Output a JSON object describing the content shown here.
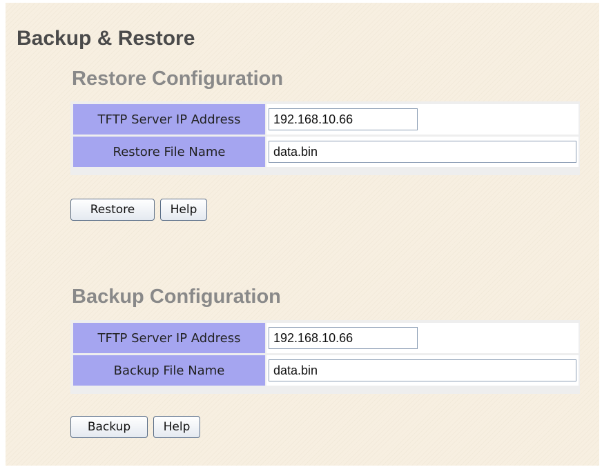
{
  "page": {
    "title": "Backup & Restore"
  },
  "restore": {
    "title": "Restore Configuration",
    "tftp_label": "TFTP Server IP Address",
    "tftp_value": "192.168.10.66",
    "file_label": "Restore File Name",
    "file_value": "data.bin",
    "action_button": "Restore",
    "help_button": "Help"
  },
  "backup": {
    "title": "Backup Configuration",
    "tftp_label": "TFTP Server IP Address",
    "tftp_value": "192.168.10.66",
    "file_label": "Backup File Name",
    "file_value": "data.bin",
    "action_button": "Backup",
    "help_button": "Help"
  },
  "colors": {
    "page_background": "#f7efe1",
    "label_cell": "#a5a5f0",
    "page_title_text": "#4a4a4a",
    "section_title_text": "#898989"
  }
}
